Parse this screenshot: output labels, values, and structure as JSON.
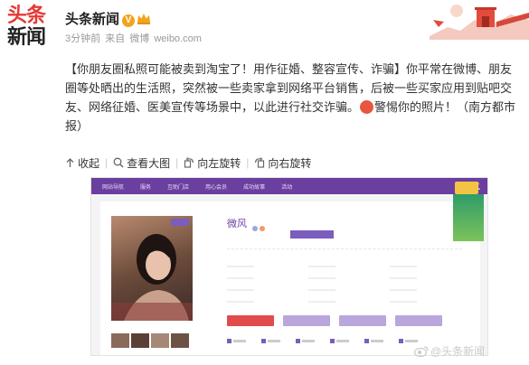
{
  "logo": {
    "line1": "头条",
    "line2": "新闻"
  },
  "account": {
    "name": "头条新闻",
    "verified_badge": "V"
  },
  "meta": {
    "time": "3分钟前",
    "source_prefix": "来自",
    "source": "微博",
    "domain": "weibo.com"
  },
  "post": {
    "text_part1": "【你朋友圈私照可能被卖到淘宝了！用作征婚、整容宣传、诈骗】你平常在微博、朋友圈等处晒出的生活照，突然被一些卖家拿到网络平台销售，后被一些买家应用到贴吧交友、网络征婚、医美宣传等场景中，以此进行社交诈骗。",
    "text_part2": "警惕你的照片！（南方都市报）"
  },
  "actions": [
    {
      "label": "收起",
      "icon": "collapse-icon"
    },
    {
      "label": "查看大图",
      "icon": "zoom-icon"
    },
    {
      "label": "向左旋转",
      "icon": "rotate-left-icon"
    },
    {
      "label": "向右旋转",
      "icon": "rotate-right-icon"
    }
  ],
  "embedded_site": {
    "nav": [
      "网站导航",
      "服务",
      "互助门店",
      "用心会员",
      "成功故事",
      "活动"
    ],
    "profile_name": "微风",
    "accent": "#6b3fa0"
  },
  "watermark": "@头条新闻",
  "colors": {
    "logo_red": "#e53935",
    "badge": "#f2a41c",
    "site_purple": "#6b3fa0",
    "emoji_red": "#e8563f"
  }
}
